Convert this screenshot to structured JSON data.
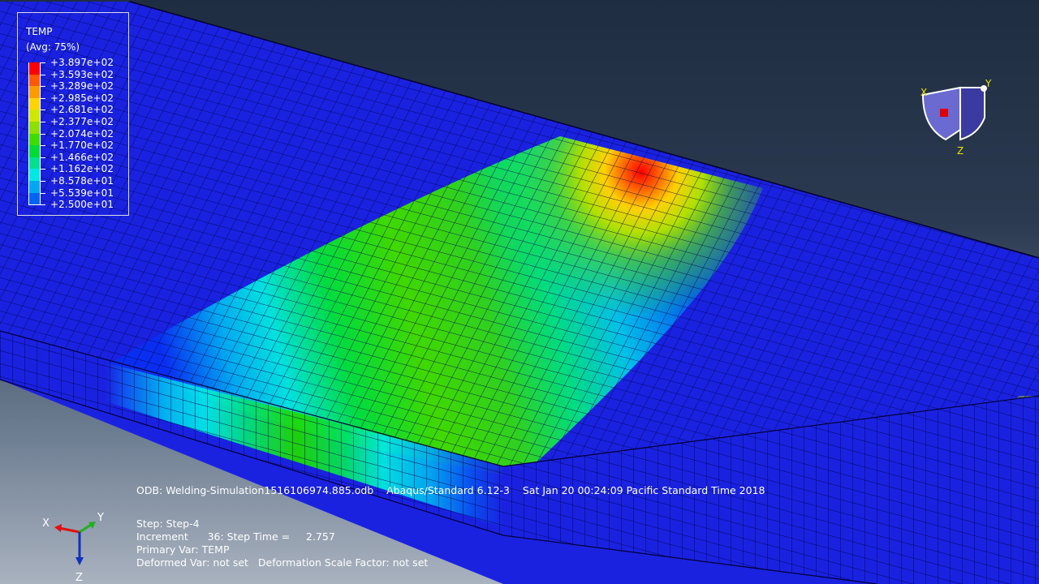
{
  "legend": {
    "title": "TEMP",
    "subtitle": "(Avg: 75%)",
    "entries": [
      {
        "value": "+3.897e+02",
        "color": "#ff0000"
      },
      {
        "value": "+3.593e+02",
        "color": "#ff5a00"
      },
      {
        "value": "+3.289e+02",
        "color": "#ff9a00"
      },
      {
        "value": "+2.985e+02",
        "color": "#ffd400"
      },
      {
        "value": "+2.681e+02",
        "color": "#cfe800"
      },
      {
        "value": "+2.377e+02",
        "color": "#8ee000"
      },
      {
        "value": "+2.074e+02",
        "color": "#3fdc00"
      },
      {
        "value": "+1.770e+02",
        "color": "#00dc34"
      },
      {
        "value": "+1.466e+02",
        "color": "#00e190"
      },
      {
        "value": "+1.162e+02",
        "color": "#00e8e2"
      },
      {
        "value": "+8.578e+01",
        "color": "#00a8f0"
      },
      {
        "value": "+5.539e+01",
        "color": "#0064f0"
      },
      {
        "value": "+2.500e+01",
        "color": "#0022e6"
      }
    ]
  },
  "info": {
    "odb_line": "ODB: Welding-Simulation1516106974.885.odb    Abaqus/Standard 6.12-3    Sat Jan 20 00:24:09 Pacific Standard Time 2018",
    "step": "Step: Step-4",
    "increment": "Increment      36: Step Time =     2.757",
    "primary_var": "Primary Var: TEMP",
    "deformed_var": "Deformed Var: not set   Deformation Scale Factor: not set"
  },
  "triad": {
    "x": "X",
    "y": "Y",
    "z": "Z"
  },
  "view_cube": {
    "x": "X",
    "y": "Y",
    "z": "Z"
  },
  "colors": {
    "mesh_base": "#1a22e0",
    "mesh_line": "#00005a",
    "axis_x": "#e01010",
    "axis_y": "#20b020",
    "axis_z": "#1030c0",
    "view_label": "#f0e000"
  }
}
